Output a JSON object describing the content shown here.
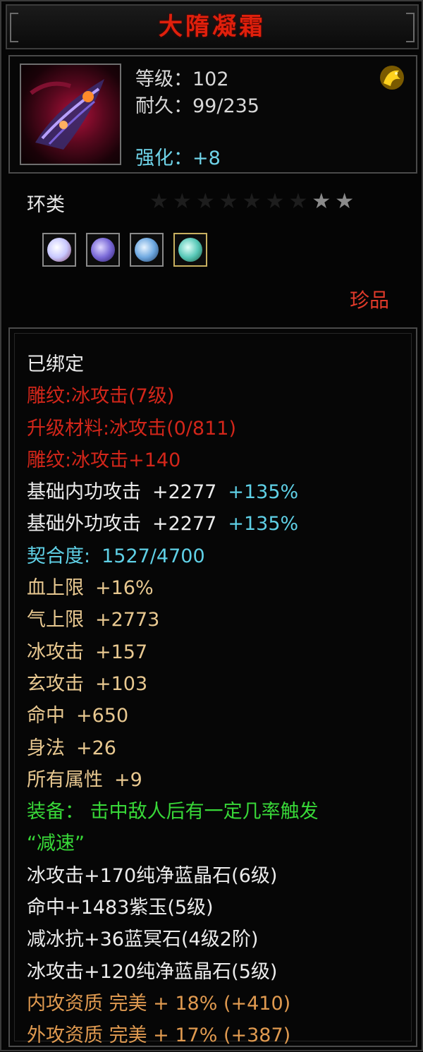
{
  "item": {
    "name": "大隋凝霜",
    "level_label": "等级：102",
    "durability_label": "耐久：99/235",
    "enhance_label": "强化：+8",
    "category": "环类",
    "stars_total": 9,
    "stars_lit": 2,
    "rarity": "珍品",
    "icon": "ring-weapon-icon",
    "badge_icon": "dragon-badge-icon"
  },
  "gems": [
    {
      "icon": "white-gem-icon",
      "color": "#e8e8ff"
    },
    {
      "icon": "purple-gem-icon",
      "color": "#7a6ad8"
    },
    {
      "icon": "blue-gem-icon",
      "color": "#6ea8e0"
    },
    {
      "icon": "teal-gem-icon",
      "color": "#58c8b8"
    }
  ],
  "attributes": {
    "bound": "已绑定",
    "engrave1": "雕纹:冰攻击(7级)",
    "upgrade_material": "升级材料:冰攻击(0/811)",
    "engrave2": "雕纹:冰攻击+140",
    "base_inner": {
      "label": "基础内功攻击",
      "value": "+2277",
      "bonus": "+135%"
    },
    "base_outer": {
      "label": "基础外功攻击",
      "value": "+2277",
      "bonus": "+135%"
    },
    "affinity": {
      "label": "契合度:",
      "value": "1527/4700"
    },
    "stats": [
      {
        "label": "血上限",
        "value": "+16%"
      },
      {
        "label": "气上限",
        "value": "+2773"
      },
      {
        "label": "冰攻击",
        "value": "+157"
      },
      {
        "label": "玄攻击",
        "value": "+103"
      },
      {
        "label": "命中",
        "value": "+650"
      },
      {
        "label": "身法",
        "value": "+26"
      },
      {
        "label": "所有属性",
        "value": "+9"
      }
    ],
    "equip_effect_1": "装备： 击中敌人后有一定几率触发",
    "equip_effect_2": "“减速”",
    "socket_lines": [
      "冰攻击+170纯净蓝晶石(6级)",
      "命中+1483紫玉(5级)",
      "减冰抗+36蓝冥石(4级2阶)",
      "冰攻击+120纯净蓝晶石(5级)"
    ],
    "quality_lines": [
      "内攻资质 完美 + 18% (+410)",
      "外攻资质 完美 + 17% (+387)"
    ]
  },
  "colors": {
    "title": "#e0200c",
    "red_attr": "#d2261a",
    "blue_attr": "#5fd0e6",
    "tan_attr": "#e8c890",
    "green_attr": "#38d838",
    "orange_attr": "#e09a50"
  }
}
